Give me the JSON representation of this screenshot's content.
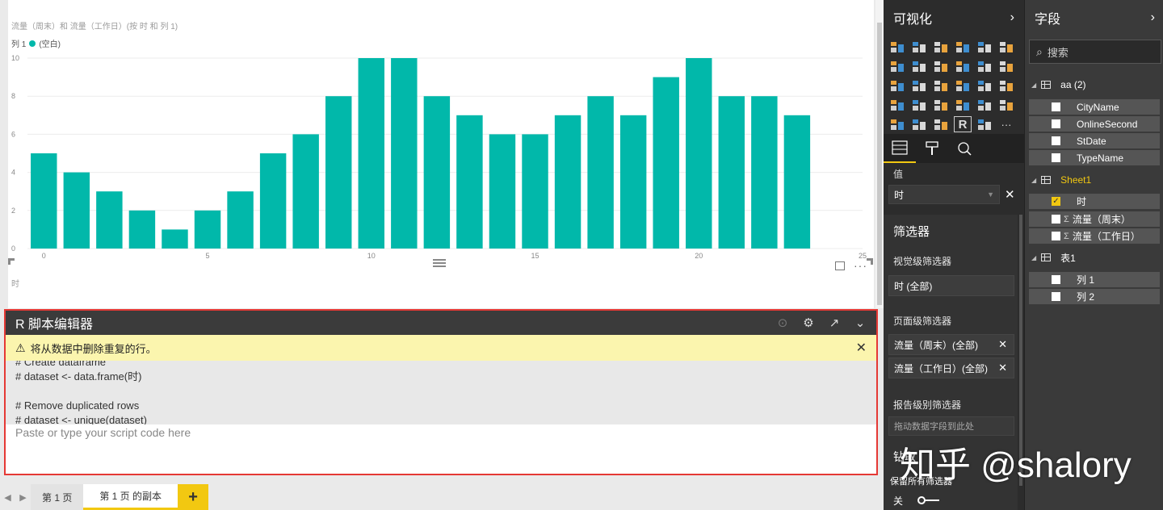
{
  "chart": {
    "title": "流量（周末）和 流量（工作日）(按 时 和 列 1)",
    "legend_prefix": "列 1",
    "legend_item": "(空白)",
    "x_axis_title": "时"
  },
  "chart_data": {
    "type": "bar",
    "x": [
      0,
      1,
      2,
      3,
      4,
      5,
      6,
      7,
      8,
      9,
      10,
      11,
      12,
      13,
      14,
      15,
      16,
      17,
      18,
      19,
      20,
      21,
      22,
      23
    ],
    "values": [
      5,
      4,
      3,
      2,
      1,
      2,
      3,
      5,
      6,
      8,
      10,
      10,
      8,
      7,
      6,
      6,
      7,
      8,
      7,
      9,
      10,
      8,
      8,
      7
    ],
    "xticks": [
      0,
      5,
      10,
      15,
      20,
      25
    ],
    "yticks": [
      0,
      2,
      4,
      6,
      8,
      10
    ],
    "ylim": [
      0,
      10
    ],
    "xlim": [
      -0.5,
      25
    ],
    "color": "#01b8aa",
    "grid": true
  },
  "r_editor": {
    "title": "R 脚本编辑器",
    "warning": "将从数据中删除重复的行。",
    "code_lines": [
      "# Create dataframe",
      "# dataset <- data.frame(时)",
      "",
      "# Remove duplicated rows",
      "# dataset <- unique(dataset)"
    ],
    "placeholder": "Paste or type your script code here"
  },
  "pages": {
    "tab1": "第 1 页",
    "tab2": "第 1 页 的副本",
    "add": "+"
  },
  "viz_pane": {
    "title": "可视化",
    "values_label": "值",
    "values_field": "时",
    "filters_title": "筛选器",
    "visual_filters_label": "视觉级筛选器",
    "visual_filter_1": "时 (全部)",
    "page_filters_label": "页面级筛选器",
    "page_filter_1": "流量（周末）(全部)",
    "page_filter_2": "流量（工作日）(全部)",
    "report_filters_label": "报告级别筛选器",
    "drop_zone": "拖动数据字段到此处",
    "drill_label": "钻取",
    "keep_all_label": "保留所有筛选器",
    "toggle_label": "关"
  },
  "fields_pane": {
    "title": "字段",
    "search_placeholder": "搜索",
    "tables": [
      {
        "name": "aa (2)",
        "fields": [
          "CityName",
          "OnlineSecond",
          "StDate",
          "TypeName"
        ]
      },
      {
        "name": "Sheet1",
        "fields": [
          "时",
          "流量（周末）",
          "流量（工作日）"
        ]
      },
      {
        "name": "表1",
        "fields": [
          "列 1",
          "列 2"
        ]
      }
    ]
  },
  "watermark": "知乎 @shalory",
  "colors": {
    "accent": "#f2c811",
    "bar": "#01b8aa",
    "highlight_border": "#e53935"
  }
}
